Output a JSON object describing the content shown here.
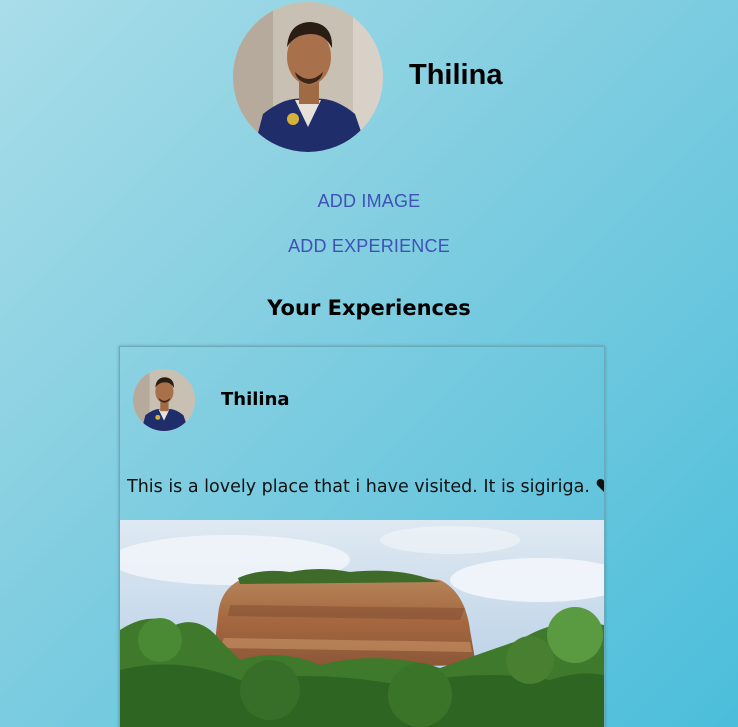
{
  "profile": {
    "name": "Thilina",
    "avatar_icon": "profile-photo"
  },
  "actions": {
    "add_image_label": "ADD IMAGE",
    "add_experience_label": "ADD EXPERIENCE"
  },
  "section": {
    "title": "Your Experiences"
  },
  "experiences": [
    {
      "author": "Thilina",
      "avatar_icon": "profile-photo",
      "text": "This is a lovely place that i have visited. It is sigiriga.",
      "emoji_icon": "heart-icon",
      "image_icon": "sigiriya-rock-photo"
    }
  ],
  "colors": {
    "link": "#3f51b5",
    "background_start": "#a9dde9",
    "background_end": "#4bbedb"
  }
}
